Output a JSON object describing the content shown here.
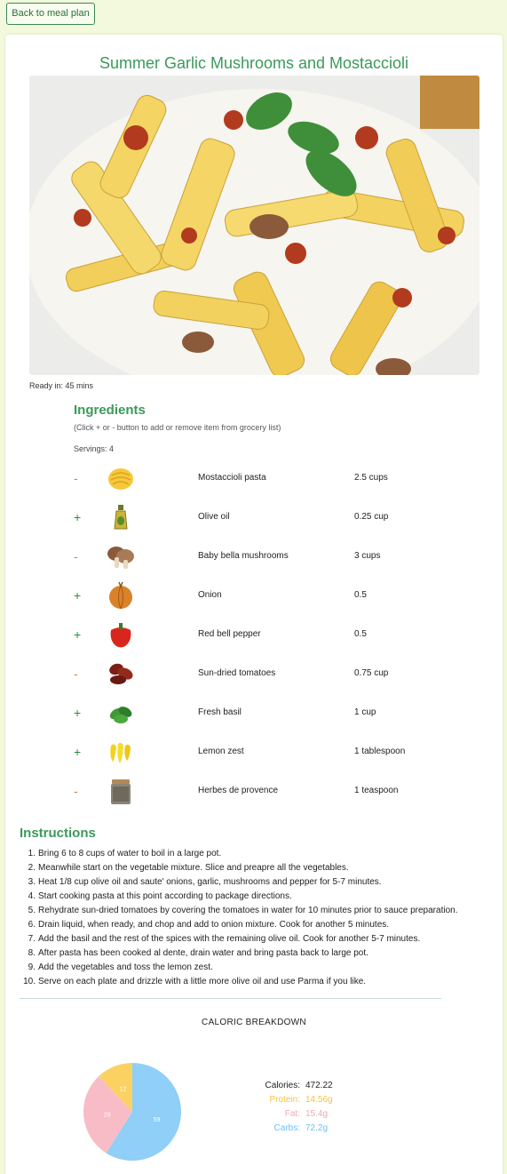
{
  "nav": {
    "back_label": "Back to meal plan"
  },
  "recipe": {
    "title": "Summer Garlic Mushrooms and Mostaccioli",
    "ready_in": "Ready in: 45 mins"
  },
  "ingredients": {
    "heading": "Ingredients",
    "hint": "(Click + or - button to add or remove item from grocery list)",
    "servings": "Servings: 4",
    "items": [
      {
        "toggle": "-",
        "name": "Mostaccioli pasta",
        "qty": "2.5 cups",
        "icon": "pasta-icon"
      },
      {
        "toggle": "+",
        "name": "Olive oil",
        "qty": "0.25 cup",
        "icon": "olive-oil-icon"
      },
      {
        "toggle": "-",
        "name": "Baby bella mushrooms",
        "qty": "3 cups",
        "icon": "mushroom-icon"
      },
      {
        "toggle": "+",
        "name": "Onion",
        "qty": "0.5",
        "icon": "onion-icon"
      },
      {
        "toggle": "+",
        "name": "Red bell pepper",
        "qty": "0.5",
        "icon": "red-pepper-icon"
      },
      {
        "toggle": "-",
        "name": "Sun-dried tomatoes",
        "qty": "0.75 cup",
        "icon": "sun-dried-tomato-icon"
      },
      {
        "toggle": "+",
        "name": "Fresh basil",
        "qty": "1 cup",
        "icon": "basil-icon"
      },
      {
        "toggle": "+",
        "name": "Lemon zest",
        "qty": "1 tablespoon",
        "icon": "lemon-zest-icon"
      },
      {
        "toggle": "-",
        "name": "Herbes de provence",
        "qty": "1 teaspoon",
        "icon": "spice-jar-icon"
      }
    ]
  },
  "instructions": {
    "heading": "Instructions",
    "steps": [
      "Bring 6 to 8 cups of water to boil in a large pot.",
      "Meanwhile start on the vegetable mixture. Slice and preapre all the vegetables.",
      "Heat 1/8 cup olive oil and saute' onions, garlic, mushrooms and pepper for 5-7 minutes.",
      "Start cooking pasta at this point according to package directions.",
      "Rehydrate sun-dried tomatoes by covering the tomatoes in water for 10 minutes prior to sauce preparation.",
      "Drain liquid, when ready, and chop and add to onion mixture. Cook for another 5 minutes.",
      "Add the basil and the rest of the spices with the remaining olive oil. Cook for another 5-7 minutes.",
      "After pasta has been cooked al dente, drain water and bring pasta back to large pot.",
      "Add the vegetables and toss the lemon zest.",
      "Serve on each plate and drizzle with a little more olive oil and use Parma if you like."
    ]
  },
  "caloric": {
    "heading": "CALORIC BREAKDOWN",
    "legend": [
      {
        "label": "Calories:",
        "value": "472.22",
        "color": "#222222"
      },
      {
        "label": "Protein:",
        "value": "14.56g",
        "color": "#f5c242"
      },
      {
        "label": "Fat:",
        "value": "15.4g",
        "color": "#f3a8b4"
      },
      {
        "label": "Carbs:",
        "value": "72.2g",
        "color": "#6cc0f5"
      }
    ]
  },
  "chart_data": {
    "type": "pie",
    "title": "CALORIC BREAKDOWN",
    "categories": [
      "Carbs",
      "Fat",
      "Protein"
    ],
    "values": [
      59,
      29,
      12
    ],
    "colors": [
      "#8fcff8",
      "#f8bcc6",
      "#fbd262"
    ]
  }
}
